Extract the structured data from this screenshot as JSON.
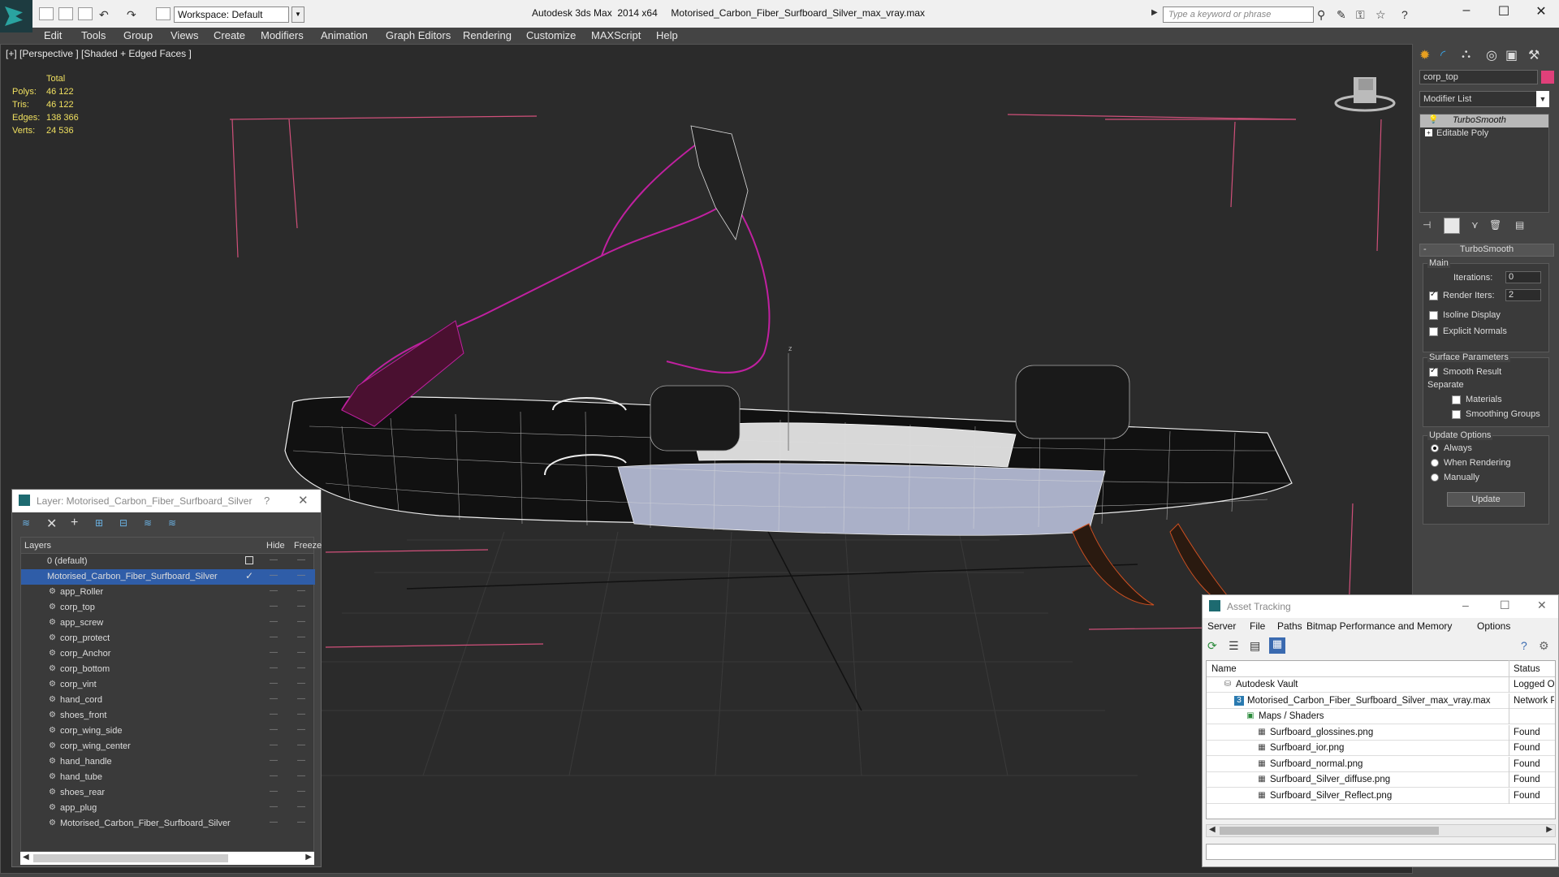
{
  "app": {
    "window_title": "Autodesk 3ds Max  2014 x64     Motorised_Carbon_Fiber_Surfboard_Silver_max_vray.max",
    "workspace": "Workspace: Default",
    "search_placeholder": "Type a keyword or phrase"
  },
  "menu": [
    "Edit",
    "Tools",
    "Group",
    "Views",
    "Create",
    "Modifiers",
    "Animation",
    "Graph Editors",
    "Rendering",
    "Customize",
    "MAXScript",
    "Help"
  ],
  "viewport": {
    "label": "[+] [Perspective ] [Shaded + Edged Faces ]",
    "stats": {
      "header": "Total",
      "rows": [
        {
          "k": "Polys:",
          "v": "46 122"
        },
        {
          "k": "Tris:",
          "v": "46 122"
        },
        {
          "k": "Edges:",
          "v": "138 366"
        },
        {
          "k": "Verts:",
          "v": "24 536"
        }
      ]
    },
    "axis_label": "z"
  },
  "command_panel": {
    "object_name": "corp_top",
    "object_color": "#e0407a",
    "modifier_list": "Modifier List",
    "stack": [
      "TurboSmooth",
      "Editable Poly"
    ],
    "rollout_title": "TurboSmooth",
    "main_label": "Main",
    "iterations_label": "Iterations:",
    "iterations": "0",
    "render_iters_label": "Render Iters:",
    "render_iters": "2",
    "isoline": "Isoline Display",
    "explicit": "Explicit Normals",
    "surface_params": "Surface Parameters",
    "smooth_result": "Smooth Result",
    "separate": "Separate",
    "materials": "Materials",
    "smoothing_groups": "Smoothing Groups",
    "update_options": "Update Options",
    "always": "Always",
    "when_rendering": "When Rendering",
    "manually": "Manually",
    "update_btn": "Update"
  },
  "layer_window": {
    "title": "Layer: Motorised_Carbon_Fiber_Surfboard_Silver",
    "help": "?",
    "col_layers": "Layers",
    "col_hide": "Hide",
    "col_freeze": "Freeze",
    "default_layer": "0 (default)",
    "main_layer": "Motorised_Carbon_Fiber_Surfboard_Silver",
    "objects": [
      "app_Roller",
      "corp_top",
      "app_screw",
      "corp_protect",
      "corp_Anchor",
      "corp_bottom",
      "corp_vint",
      "hand_cord",
      "shoes_front",
      "corp_wing_side",
      "corp_wing_center",
      "hand_handle",
      "hand_tube",
      "shoes_rear",
      "app_plug",
      "Motorised_Carbon_Fiber_Surfboard_Silver"
    ]
  },
  "asset_tracking": {
    "title": "Asset Tracking",
    "menu": [
      "Server",
      "File",
      "Paths",
      "Bitmap Performance and Memory",
      "Options"
    ],
    "col_name": "Name",
    "col_status": "Status",
    "rows": [
      {
        "name": "Autodesk Vault",
        "status": "Logged Ou",
        "indent": 1
      },
      {
        "name": "Motorised_Carbon_Fiber_Surfboard_Silver_max_vray.max",
        "status": "Network P",
        "indent": 2
      },
      {
        "name": "Maps / Shaders",
        "status": "",
        "indent": 3
      },
      {
        "name": "Surfboard_glossines.png",
        "status": "Found",
        "indent": 4
      },
      {
        "name": "Surfboard_ior.png",
        "status": "Found",
        "indent": 4
      },
      {
        "name": "Surfboard_normal.png",
        "status": "Found",
        "indent": 4
      },
      {
        "name": "Surfboard_Silver_diffuse.png",
        "status": "Found",
        "indent": 4
      },
      {
        "name": "Surfboard_Silver_Reflect.png",
        "status": "Found",
        "indent": 4
      }
    ]
  }
}
